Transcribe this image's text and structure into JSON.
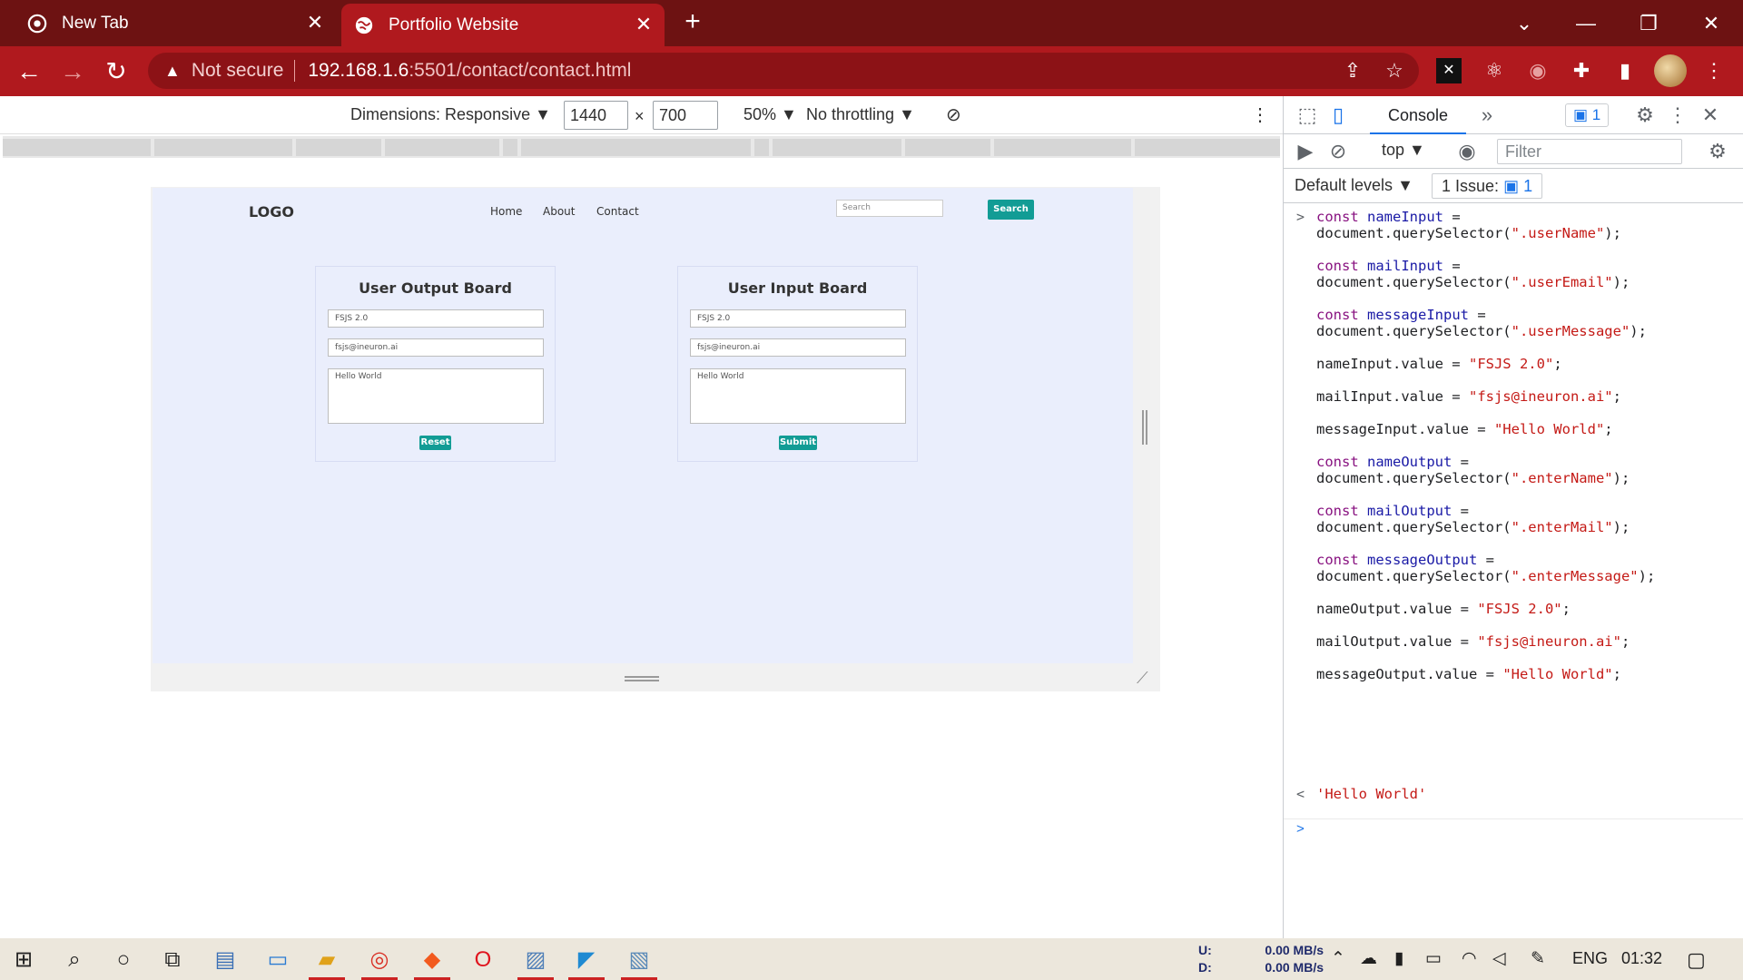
{
  "browser": {
    "tabs": [
      {
        "title": "New Tab",
        "active": false
      },
      {
        "title": "Portfolio Website",
        "active": true
      }
    ],
    "new_tab_icon": "plus-icon",
    "address": {
      "security_label": "Not secure",
      "host": "192.168.1.6",
      "path": ":5501/contact/contact.html"
    },
    "colors": {
      "tabstrip": "#6d1212",
      "toolbar": "#b0191e"
    }
  },
  "device_toolbar": {
    "dimensions_label": "Dimensions: Responsive",
    "width_value": "1440",
    "times": "×",
    "height_value": "700",
    "zoom": "50%",
    "throttling": "No throttling"
  },
  "site": {
    "logo": "LOGO",
    "nav": [
      "Home",
      "About",
      "Contact"
    ],
    "search_placeholder": "Search",
    "search_button": "Search",
    "output_board": {
      "title": "User Output Board",
      "name": "FSJS 2.0",
      "email": "fsjs@ineuron.ai",
      "message": "Hello World",
      "button": "Reset"
    },
    "input_board": {
      "title": "User Input Board",
      "name": "FSJS 2.0",
      "email": "fsjs@ineuron.ai",
      "message": "Hello World",
      "button": "Submit"
    },
    "accent_color": "#129c95",
    "background_color": "#eaeefc"
  },
  "devtools": {
    "tab": "Console",
    "issues_count": "1",
    "context": "top",
    "filter_placeholder": "Filter",
    "levels": "Default levels",
    "issues_label": "1 Issue:",
    "issues_link_count": "1",
    "console_lines": [
      {
        "kw": "const",
        "name": " nameInput",
        "rest": " ="
      },
      {
        "text": "document.querySelector(",
        "str": "\".userName\"",
        "end": ");"
      },
      {
        "kw": "const",
        "name": " mailInput",
        "rest": " ="
      },
      {
        "text": "document.querySelector(",
        "str": "\".userEmail\"",
        "end": ");"
      },
      {
        "kw": "const",
        "name": " messageInput",
        "rest": " ="
      },
      {
        "text": "document.querySelector(",
        "str": "\".userMessage\"",
        "end": ");"
      },
      {
        "text": "nameInput.value = ",
        "str": "\"FSJS 2.0\"",
        "end": ";"
      },
      {
        "text": "mailInput.value = ",
        "str": "\"fsjs@ineuron.ai\"",
        "end": ";"
      },
      {
        "text": "messageInput.value = ",
        "str": "\"Hello World\"",
        "end": ";"
      },
      {
        "kw": "const",
        "name": " nameOutput",
        "rest": " ="
      },
      {
        "text": "document.querySelector(",
        "str": "\".enterName\"",
        "end": ");"
      },
      {
        "kw": "const",
        "name": " mailOutput",
        "rest": " ="
      },
      {
        "text": "document.querySelector(",
        "str": "\".enterMail\"",
        "end": ");"
      },
      {
        "kw": "const",
        "name": " messageOutput",
        "rest": " ="
      },
      {
        "text": "document.querySelector(",
        "str": "\".enterMessage\"",
        "end": ");"
      },
      {
        "text": "nameOutput.value = ",
        "str": "\"FSJS 2.0\"",
        "end": ";"
      },
      {
        "text": "mailOutput.value = ",
        "str": "\"fsjs@ineuron.ai\"",
        "end": ";"
      },
      {
        "text": "messageOutput.value = ",
        "str": "\"Hello World\"",
        "end": ";"
      }
    ],
    "result": "'Hello World'"
  },
  "taskbar": {
    "net_labels": [
      "U:",
      "D:"
    ],
    "net_values": [
      "0.00 MB/s",
      "0.00 MB/s"
    ],
    "language": "ENG",
    "time": "01:32",
    "icons": [
      "windows-start-icon",
      "search-icon",
      "cortana-icon",
      "task-view-icon",
      "network-app-icon",
      "computer-icon",
      "file-explorer-icon",
      "chrome-icon",
      "brave-icon",
      "opera-icon",
      "image-viewer-icon",
      "vscode-icon",
      "notes-icon"
    ]
  }
}
